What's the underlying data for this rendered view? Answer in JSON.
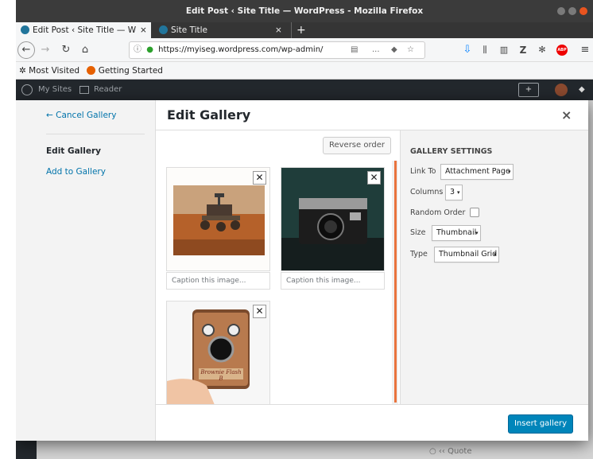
{
  "window": {
    "title": "Edit Post ‹ Site Title — WordPress - Mozilla Firefox"
  },
  "browser": {
    "tabs": [
      {
        "label": "Edit Post ‹ Site Title — W",
        "close": "×"
      },
      {
        "label": "Site Title",
        "close": "×"
      }
    ],
    "new_tab": "+",
    "url": "https://myiseg.wordpress.com/wp-admin/",
    "url_overflow": "...",
    "bookmarks": [
      {
        "label": "Most Visited"
      },
      {
        "label": "Getting Started"
      }
    ]
  },
  "wp_admin_bar": {
    "my_sites": "My Sites",
    "reader": "Reader"
  },
  "modal": {
    "menu": {
      "cancel": "← Cancel Gallery",
      "edit_gallery": "Edit Gallery",
      "add_to_gallery": "Add to Gallery"
    },
    "title": "Edit Gallery",
    "close": "×",
    "reverse_order": "Reverse order",
    "images": [
      {
        "caption_placeholder": "Caption this image..."
      },
      {
        "caption_placeholder": "Caption this image..."
      },
      {
        "caption_placeholder": ""
      }
    ],
    "camera_label": "Brownie Flash B",
    "settings": {
      "heading": "GALLERY SETTINGS",
      "link_to_label": "Link To",
      "link_to_value": "Attachment Page",
      "columns_label": "Columns",
      "columns_value": "3",
      "random_order_label": "Random Order",
      "random_order_checked": false,
      "size_label": "Size",
      "size_value": "Thumbnail",
      "type_label": "Type",
      "type_value": "Thumbnail Grid"
    },
    "insert_button": "Insert gallery"
  },
  "background": {
    "quote": "Quote"
  },
  "colors": {
    "accent": "#0085ba",
    "link": "#0073aa",
    "scroll_accent": "#e9733d"
  }
}
